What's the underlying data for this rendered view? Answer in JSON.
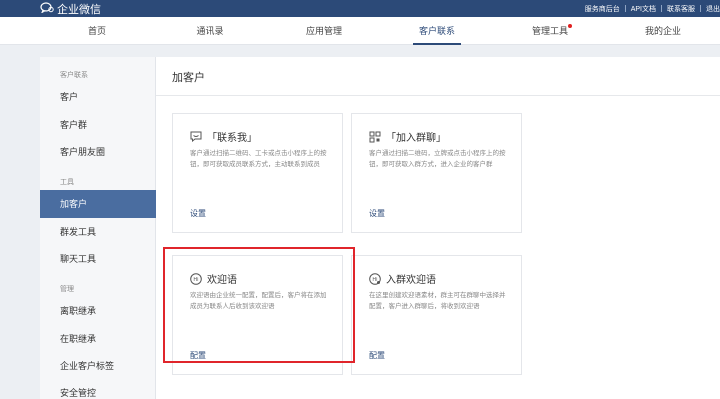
{
  "app": {
    "name": "企业微信"
  },
  "top_links": [
    "服务商后台",
    "API文档",
    "联系客服",
    "退出"
  ],
  "nav": {
    "tabs": [
      {
        "label": "首页"
      },
      {
        "label": "通讯录"
      },
      {
        "label": "应用管理"
      },
      {
        "label": "客户联系",
        "active": true
      },
      {
        "label": "管理工具",
        "badge": true
      },
      {
        "label": "我的企业"
      }
    ]
  },
  "sidebar": {
    "sections": [
      {
        "title": "客户联系",
        "items": [
          "客户",
          "客户群",
          "客户朋友圈"
        ]
      },
      {
        "title": "工具",
        "items": [
          "加客户",
          "群发工具",
          "聊天工具"
        ]
      },
      {
        "title": "管理",
        "items": [
          "离职继承",
          "在职继承",
          "企业客户标签",
          "安全管控"
        ]
      }
    ],
    "active_item": "加客户"
  },
  "main": {
    "title": "加客户",
    "cards": [
      {
        "title": "「联系我」",
        "icon": "chat-bubble-icon",
        "desc": "客户通过扫描二维码、工卡或点击小程序上的按钮，即可获取成员联系方式，主动联系到成员",
        "link": "设置"
      },
      {
        "title": "「加入群聊」",
        "icon": "group-qr-icon",
        "desc": "客户通过扫描二维码，立牌或点击小程序上的按钮，即可获取入群方式，进入企业的客户群",
        "link": "设置"
      },
      {
        "title": "欢迎语",
        "icon": "hi-icon",
        "desc": "欢迎语由企业统一配置，配置后，客户将在添加成员为联系人后收到该欢迎语",
        "link": "配置"
      },
      {
        "title": "入群欢迎语",
        "icon": "hi-group-icon",
        "desc": "在这里创建欢迎语素材，群主可在群聊中选择并配置，客户进入群聊后，将收到欢迎语",
        "link": "配置"
      }
    ]
  },
  "colors": {
    "brand": "#2c4a78",
    "active_side": "#4a6da0",
    "highlight": "#e0252b",
    "badge": "#e02020"
  }
}
